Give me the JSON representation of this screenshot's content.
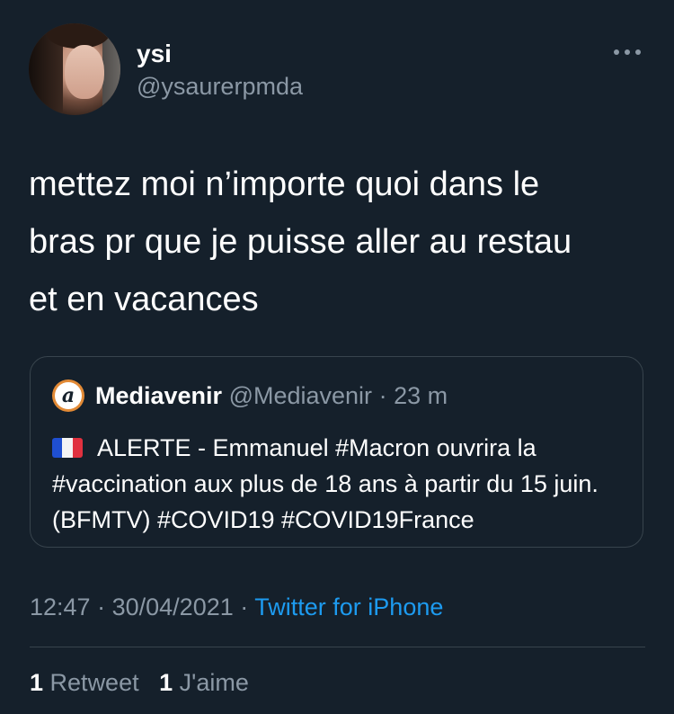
{
  "author": {
    "display_name": "ysi",
    "handle": "@ysaurerpmda",
    "avatar_icon": "user-avatar"
  },
  "more_icon": "more-horizontal-icon",
  "tweet": {
    "text": "mettez moi n’importe quoi dans le\nbras pr que je puisse aller au restau\net en vacances"
  },
  "quoted_tweet": {
    "logo_letter": "a",
    "logo_color": "#e28a36",
    "name": "Mediavenir",
    "handle": "@Mediavenir",
    "separator": "·",
    "time": "23 m",
    "flag_icon": "france-flag-icon",
    "text": "ALERTE - Emmanuel #Macron ouvrira la #vaccination aux plus de 18 ans à partir du 15 juin. (BFMTV) #COVID19 #COVID19France"
  },
  "meta": {
    "time": "12:47",
    "separator": "·",
    "date": "30/04/2021",
    "separator2": "·",
    "source": "Twitter for iPhone"
  },
  "stats": {
    "retweet_count": "1",
    "retweet_label": "Retweet",
    "like_count": "1",
    "like_label": "J'aime"
  },
  "colors": {
    "background": "#15202b",
    "text_primary": "#ffffff",
    "text_secondary": "#8b98a5",
    "link": "#1d9bf0",
    "border": "#38444d"
  }
}
